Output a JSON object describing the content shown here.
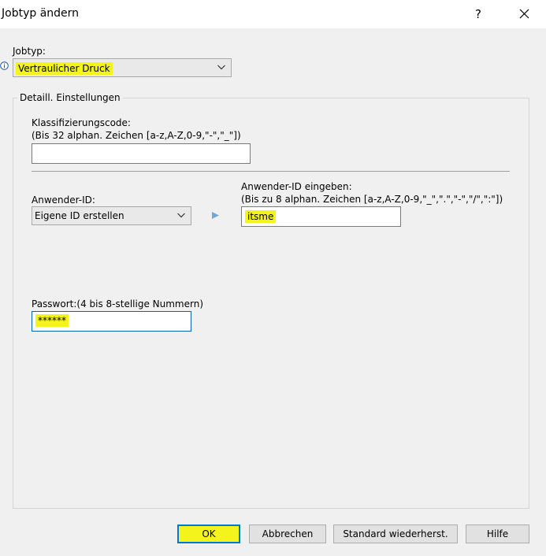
{
  "dialog": {
    "title": "Jobtyp ändern",
    "help_glyph": "?"
  },
  "jobtyp": {
    "label": "Jobtyp:",
    "info_glyph": "i",
    "selected": "Vertraulicher Druck"
  },
  "group": {
    "legend": "Detaill. Einstellungen",
    "klassifizierung": {
      "label_line1": "Klassifizierungscode:",
      "label_line2": "(Bis 32 alphan. Zeichen [a-z,A-Z,0-9,\"-\",\"_\"])",
      "value": ""
    },
    "anwender_id": {
      "label": "Anwender-ID:",
      "selected": "Eigene ID erstellen"
    },
    "anwender_id_eingeben": {
      "label_line1": "Anwender-ID eingeben:",
      "label_line2": "(Bis zu 8 alphan. Zeichen [a-z,A-Z,0-9,\"_\",\".\",\"-\",\"/\",\":\"])",
      "value": "itsme"
    },
    "passwort": {
      "label": "Passwort:(4 bis 8-stellige Nummern)",
      "value": "******"
    }
  },
  "buttons": {
    "ok": "OK",
    "cancel": "Abbrechen",
    "defaults": "Standard wiederherst.",
    "help": "Hilfe"
  },
  "colors": {
    "highlight": "#f4f31b",
    "focus_border": "#0a63b8",
    "default_button_border": "#0078d7",
    "info_icon": "#1c5fb0",
    "arrow": "#6fa8dc"
  }
}
